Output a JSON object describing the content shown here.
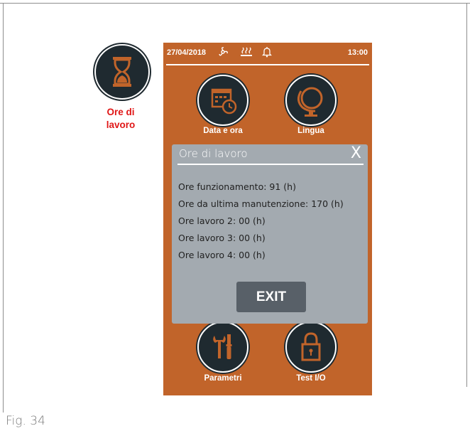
{
  "figure": {
    "caption": "Fig. 34"
  },
  "side_shortcut": {
    "icon": "hourglass-icon",
    "label_line1": "Ore di",
    "label_line2": "lavoro",
    "label_color": "#e01616"
  },
  "status_bar": {
    "date": "27/04/2018",
    "time": "13:00",
    "icons": [
      "fan-icon",
      "heating-waves-icon",
      "bell-icon"
    ]
  },
  "menu": {
    "items": [
      {
        "label": "Data e ora",
        "icon": "calendar-clock-icon"
      },
      {
        "label": "Lingua",
        "icon": "globe-icon"
      },
      {
        "label": "Parametri",
        "icon": "tools-icon"
      },
      {
        "label": "Test I/O",
        "icon": "padlock-icon"
      }
    ]
  },
  "dialog": {
    "title": "Ore di lavoro",
    "close_label": "X",
    "lines": [
      "Ore funzionamento: 91 (h)",
      "Ore da ultima manutenzione: 170 (h)",
      "Ore lavoro 2: 00 (h)",
      "Ore lavoro 3: 00 (h)",
      "Ore lavoro 4: 00 (h)"
    ],
    "exit_label": "EXIT"
  },
  "colors": {
    "screen_background": "#c1642a",
    "icon_circle": "#1f2a30",
    "dialog_background": "#a3aab0",
    "exit_button": "#586068"
  }
}
